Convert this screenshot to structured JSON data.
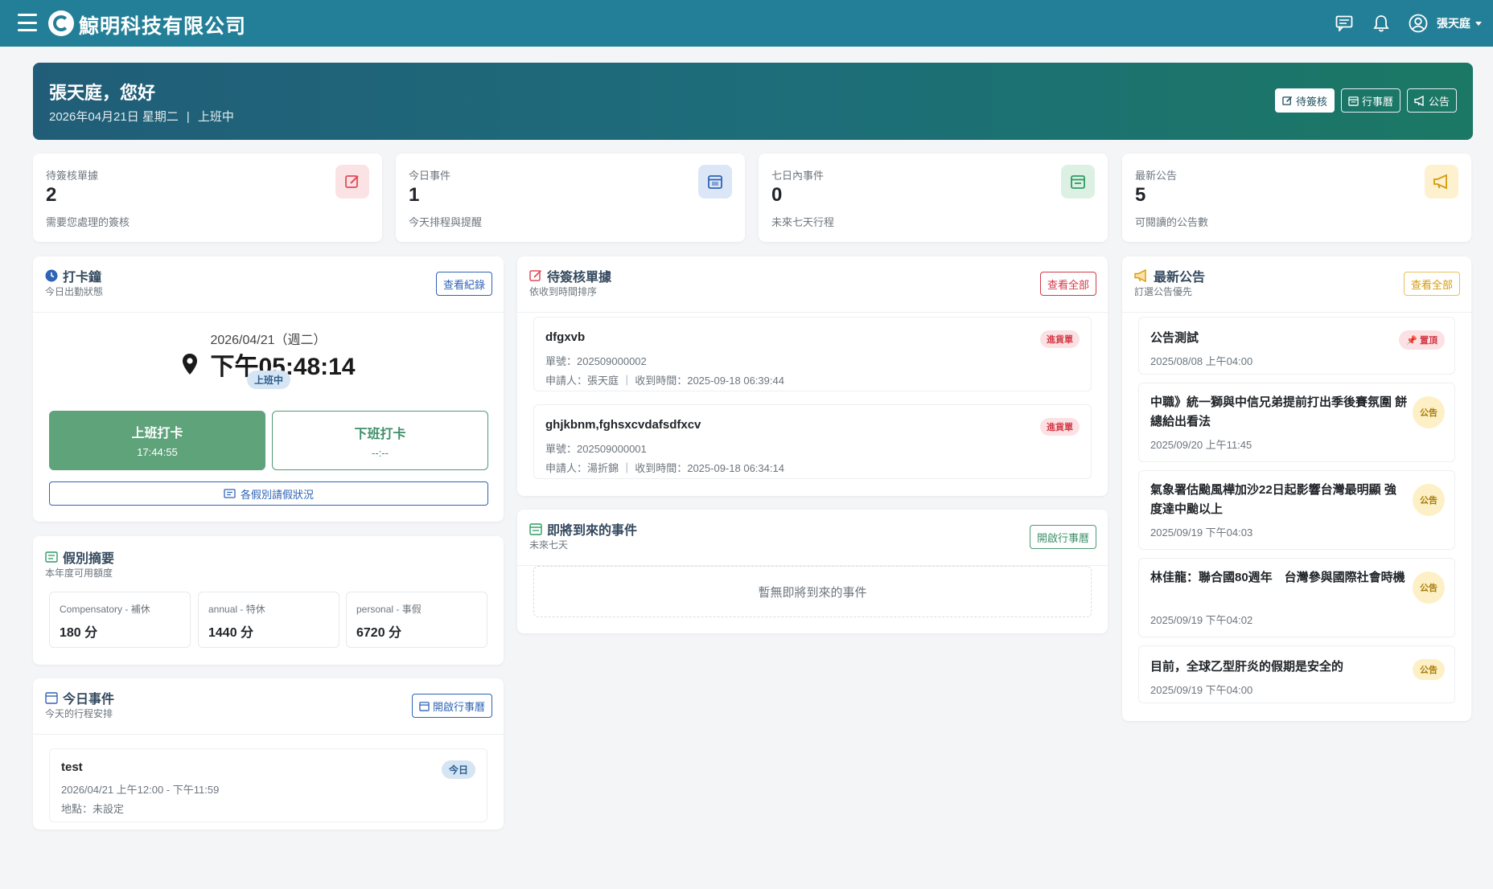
{
  "topbar": {
    "company_name": "鯨明科技有限公司",
    "user_name": "張天庭"
  },
  "welcome": {
    "greeting": "張天庭，您好",
    "date": "2026年04月21日 星期二",
    "separator": "|",
    "status": "上班中",
    "buttons": {
      "pending": "待簽核",
      "calendar": "行事曆",
      "announcements": "公告"
    }
  },
  "stats": [
    {
      "label": "待簽核單據",
      "value": "2",
      "sub": "需要您處理的簽核",
      "icon": "pencil-square-icon",
      "color": "#e14b5a"
    },
    {
      "label": "今日事件",
      "value": "1",
      "sub": "今天排程與提醒",
      "icon": "calendar-day-icon",
      "color": "#2f63b5"
    },
    {
      "label": "七日內事件",
      "value": "0",
      "sub": "未來七天行程",
      "icon": "calendar-week-icon",
      "color": "#2e9a63"
    },
    {
      "label": "最新公告",
      "value": "5",
      "sub": "可閱讀的公告數",
      "icon": "megaphone-icon",
      "color": "#d79a0a"
    }
  ],
  "clock": {
    "title": "打卡鐘",
    "subtitle": "今日出勤狀態",
    "view_records": "查看紀錄",
    "date": "2026/04/21（週二）",
    "time": "下午05:48:14",
    "status": "上班中",
    "clock_in_label": "上班打卡",
    "clock_in_time": "17:44:55",
    "clock_out_label": "下班打卡",
    "clock_out_time": "--:--",
    "leave_status": "各假別請假狀況"
  },
  "leave_summary": {
    "title": "假別摘要",
    "subtitle": "本年度可用額度",
    "items": [
      {
        "label": "Compensatory - 補休",
        "value": "180 分"
      },
      {
        "label": "annual - 特休",
        "value": "1440 分"
      },
      {
        "label": "personal - 事假",
        "value": "6720 分"
      }
    ]
  },
  "today_events": {
    "title": "今日事件",
    "subtitle": "今天的行程安排",
    "open_calendar": "開啟行事曆",
    "items": [
      {
        "title": "test",
        "time": "2026/04/21 上午12:00 - 下午11:59",
        "location": "地點：未設定",
        "badge": "今日"
      }
    ]
  },
  "pending": {
    "title": "待簽核單據",
    "subtitle": "依收到時間排序",
    "view_all": "查看全部",
    "items": [
      {
        "title": "dfgxvb",
        "number": "單號：202509000002",
        "meta": "申請人：張天庭 ｜ 收到時間：2025-09-18 06:39:44",
        "badge": "進貨單"
      },
      {
        "title": "ghjkbnm,fghsxcvdafsdfxcv",
        "number": "單號：202509000001",
        "meta": "申請人：湯折錦 ｜ 收到時間：2025-09-18 06:34:14",
        "badge": "進貨單"
      }
    ]
  },
  "upcoming": {
    "title": "即將到來的事件",
    "subtitle": "未來七天",
    "open_calendar": "開啟行事曆",
    "empty": "暫無即將到來的事件"
  },
  "announcements": {
    "title": "最新公告",
    "subtitle": "訂選公告優先",
    "view_all": "查看全部",
    "items": [
      {
        "title": "公告測試",
        "date": "2025/08/08 上午04:00",
        "badge": "置頂"
      },
      {
        "title": "中職》統一獅與中信兄弟提前打出季後賽氛圍 餅總給出看法",
        "date": "2025/09/20 上午11:45",
        "badge": "公告"
      },
      {
        "title": "氣象署估颱風樺加沙22日起影響台灣最明顯 強度達中颱以上",
        "date": "2025/09/19 下午04:03",
        "badge": "公告"
      },
      {
        "title": "林佳龍：聯合國80週年　台灣參與國際社會時機",
        "date": "2025/09/19 下午04:02",
        "badge": "公告"
      },
      {
        "title": "目前，全球乙型肝炎的假期是安全的",
        "date": "2025/09/19 下午04:00",
        "badge": "公告"
      }
    ]
  },
  "colors": {
    "topbar": "#237f97",
    "accent_red": "#d23a47",
    "accent_green": "#4e9a74",
    "accent_blue": "#2f63b5",
    "accent_gold": "#d79a0a"
  }
}
